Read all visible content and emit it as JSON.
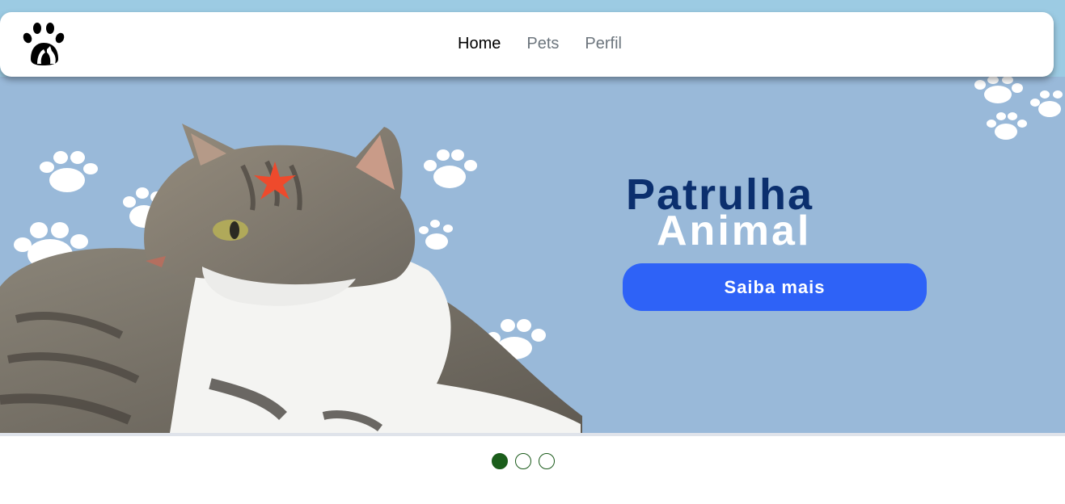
{
  "nav": {
    "links": [
      {
        "label": "Home",
        "active": true
      },
      {
        "label": "Pets",
        "active": false
      },
      {
        "label": "Perfil",
        "active": false
      }
    ]
  },
  "hero": {
    "title_line1": "Patrulha",
    "title_line2": "Animal",
    "cta_label": "Saiba mais",
    "background_color": "#99b9d9",
    "title_color": "#0b2f6e",
    "cta_color": "#2e62f7"
  },
  "carousel": {
    "slides": 3,
    "active_index": 0,
    "indicator_color": "#1b5e1b"
  },
  "icons": {
    "logo": "paw-with-pets-logo-icon",
    "decoration": "paw-print-icon"
  }
}
